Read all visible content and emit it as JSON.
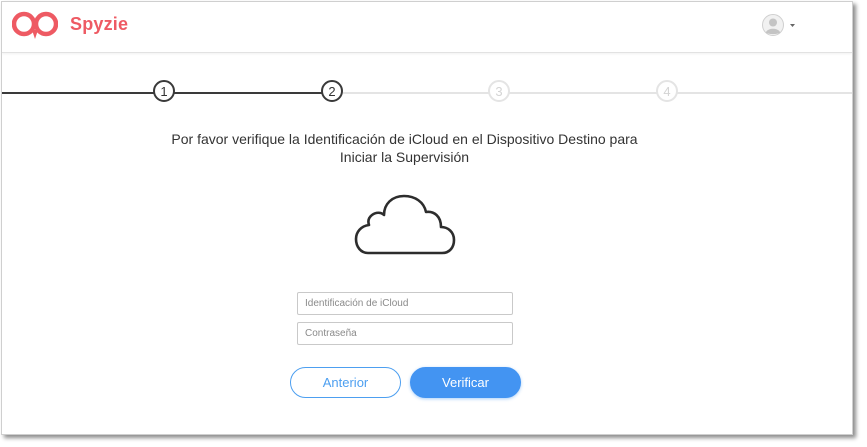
{
  "header": {
    "brand": "Spyzie",
    "brand_color": "#ee5a63",
    "logo_icon": "binoculars-chat-icon",
    "account_icon": "user-avatar-icon"
  },
  "stepper": {
    "steps": [
      {
        "label": "1",
        "state": "complete"
      },
      {
        "label": "2",
        "state": "current"
      },
      {
        "label": "3",
        "state": "pending"
      },
      {
        "label": "4",
        "state": "pending"
      }
    ],
    "active_color": "#3a3a3a",
    "inactive_color": "#e4e4e4"
  },
  "main": {
    "heading": "Por favor verifique la Identificación de iCloud en el Dispositivo Destino para Iniciar la Supervisión",
    "illustration": "cloud-icon",
    "icloud_id_placeholder": "Identificación de iCloud",
    "icloud_id_value": "",
    "password_placeholder": "Contraseña",
    "password_value": ""
  },
  "actions": {
    "back_label": "Anterior",
    "verify_label": "Verificar",
    "accent_color": "#4394f2"
  }
}
